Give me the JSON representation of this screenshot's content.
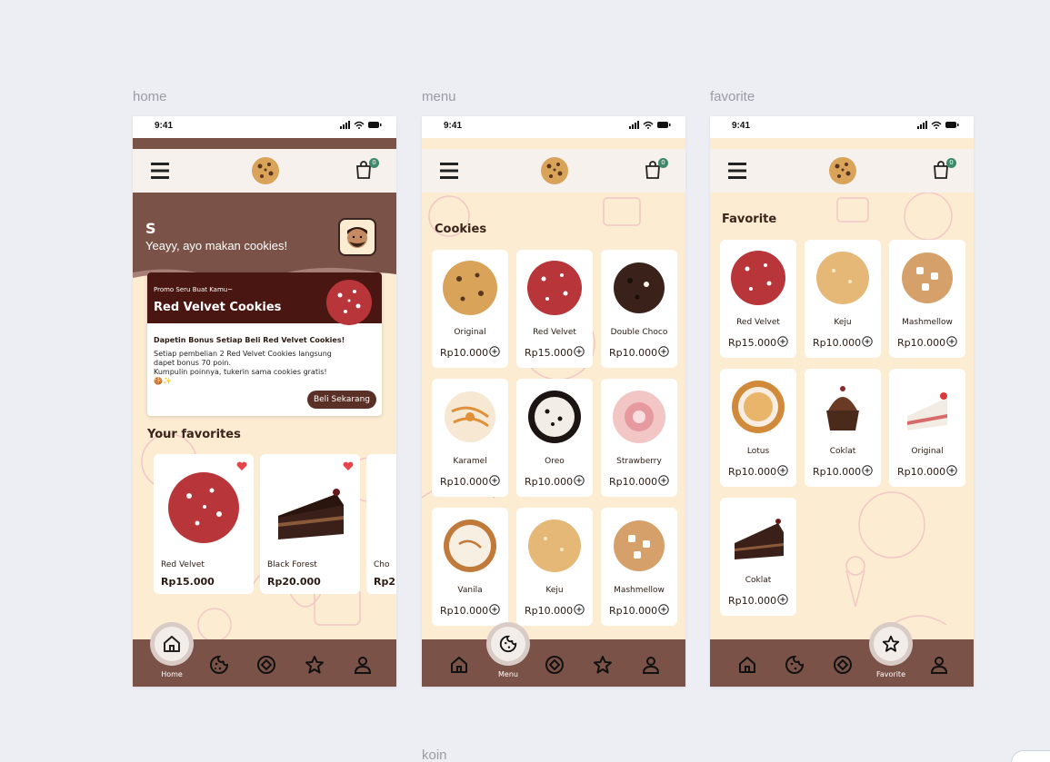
{
  "frames": {
    "home": "home",
    "menu": "menu",
    "favorite": "favorite",
    "koin": "koin"
  },
  "status": {
    "time": "9:41"
  },
  "header": {
    "cart_count": "0"
  },
  "home": {
    "user_initial": "S",
    "greeting": "Yeayy, ayo makan cookies!",
    "promo": {
      "kicker": "Promo Seru Buat Kamu~",
      "title": "Red Velvet Cookies",
      "headline": "Dapetin Bonus Setiap Beli Red Velvet Cookies!",
      "line1": "Setiap pembelian 2 Red Velvet Cookies langsung",
      "line2": "dapet bonus 70 poin.",
      "line3": "Kumpulin poinnya, tukerin sama cookies gratis!",
      "line4": "🍪✨",
      "cta": "Beli Sekarang"
    },
    "favorites_title": "Your favorites",
    "favorites": [
      {
        "name": "Red Velvet",
        "price": "Rp15.000"
      },
      {
        "name": "Black Forest",
        "price": "Rp20.000"
      },
      {
        "name": "Cho",
        "price": "Rp2"
      }
    ]
  },
  "menu": {
    "title": "Cookies",
    "items": [
      {
        "name": "Original",
        "price": "Rp10.000"
      },
      {
        "name": "Red Velvet",
        "price": "Rp15.000"
      },
      {
        "name": "Double Choco",
        "price": "Rp10.000"
      },
      {
        "name": "Karamel",
        "price": "Rp10.000"
      },
      {
        "name": "Oreo",
        "price": "Rp10.000"
      },
      {
        "name": "Strawberry",
        "price": "Rp10.000"
      },
      {
        "name": "Vanila",
        "price": "Rp10.000"
      },
      {
        "name": "Keju",
        "price": "Rp10.000"
      },
      {
        "name": "Mashmellow",
        "price": "Rp10.000"
      }
    ]
  },
  "favorite": {
    "title": "Favorite",
    "items": [
      {
        "name": "Red Velvet",
        "price": "Rp15.000"
      },
      {
        "name": "Keju",
        "price": "Rp10.000"
      },
      {
        "name": "Mashmellow",
        "price": "Rp10.000"
      },
      {
        "name": "Lotus",
        "price": "Rp10.000"
      },
      {
        "name": "Coklat",
        "price": "Rp10.000"
      },
      {
        "name": "Original",
        "price": "Rp10.000"
      },
      {
        "name": "Coklat",
        "price": "Rp10.000"
      }
    ]
  },
  "nav": {
    "home": "Home",
    "menu": "Menu",
    "favorite": "Favorite"
  },
  "colors": {
    "brown": "#7a5248",
    "dark_red": "#4a1612",
    "cream": "#fbecd2",
    "accent_green": "#3f8a6a",
    "heart": "#e8434a"
  }
}
